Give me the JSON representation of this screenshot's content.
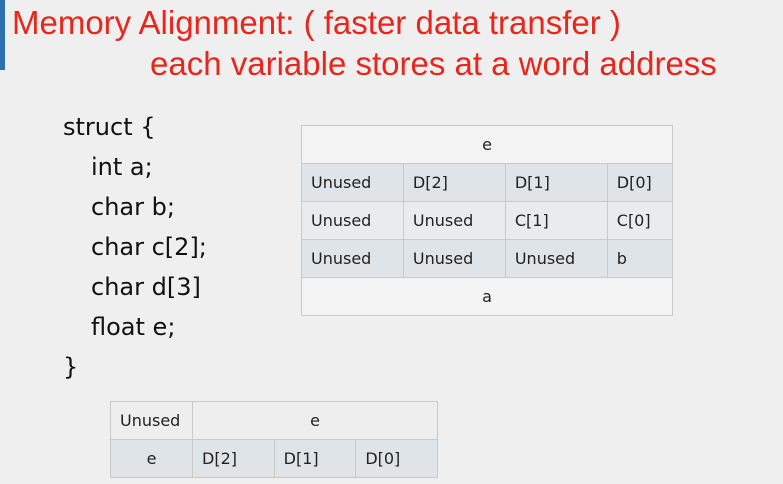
{
  "title": {
    "line1": "Memory Alignment:   ( faster data transfer )",
    "line2": "each variable stores at a word address"
  },
  "code": {
    "lines": [
      "struct {",
      "int a;",
      "char b;",
      "char c[2];",
      "char d[3]",
      "float e;",
      "}"
    ]
  },
  "big_table": {
    "header": "e",
    "rows": [
      [
        "Unused",
        "D[2]",
        "D[1]",
        "D[0]"
      ],
      [
        "Unused",
        "Unused",
        "C[1]",
        "C[0]"
      ],
      [
        "Unused",
        "Unused",
        "Unused",
        "b"
      ]
    ],
    "footer": "a"
  },
  "small_table": {
    "row1": [
      "Unused",
      "e"
    ],
    "row2": [
      "e",
      "D[2]",
      "D[1]",
      "D[0]"
    ]
  }
}
